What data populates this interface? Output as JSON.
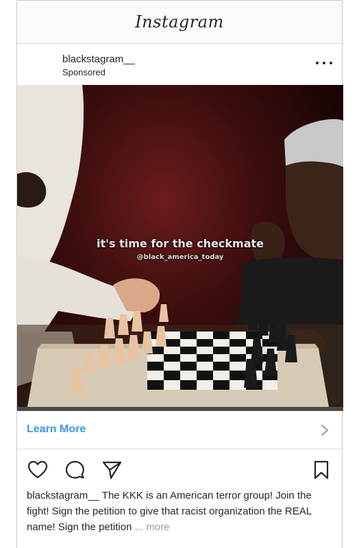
{
  "app": {
    "title": "Instagram"
  },
  "post": {
    "username": "blackstagram__",
    "label": "Sponsored",
    "image": {
      "overlay_title": "it's time for the checkmate",
      "overlay_handle": "@black_america_today"
    },
    "cta": {
      "label": "Learn More"
    },
    "caption": {
      "username": "blackstagram__",
      "text": "The KKK is an American terror group! Join the fight! Sign the petition to give that racist organization the REAL name! Sign the petition",
      "ellipsis": "...",
      "more": "more"
    }
  },
  "icons": {
    "options": "more-options-icon",
    "like": "heart-icon",
    "comment": "comment-icon",
    "share": "paper-plane-icon",
    "save": "bookmark-icon",
    "chevron": "chevron-right-icon"
  },
  "colors": {
    "link_blue": "#3897f0",
    "text": "#262626",
    "muted": "#999999",
    "divider": "#dbdbdb"
  }
}
